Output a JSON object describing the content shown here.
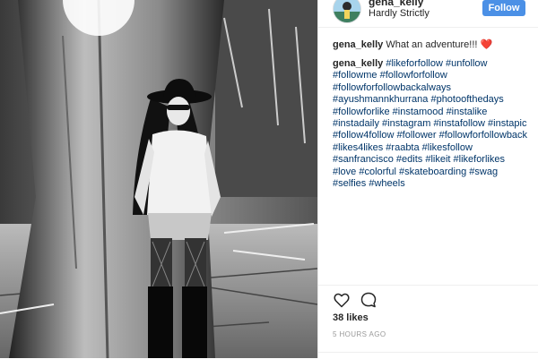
{
  "post": {
    "username": "gena_kelly",
    "location": "Hardly Strictly",
    "follow_label": "Follow",
    "caption": {
      "username": "gena_kelly",
      "text": "What an adventure!!! ❤️"
    },
    "hashtag_comment": {
      "username": "gena_kelly",
      "text": "#likeforfollow #unfollow #followme #followforfollow #followforfollowbackalways #ayushmannkhurrana #photoofthedays #followforlike #instamood #instalike #instadaily #instagram #instafollow #instapic #follow4follow #follower #followforfollowback #likes4likes #raabta #likesfollow #sanfrancisco #edits #likeit #likeforlikes #love #colorful #skateboarding #swag #selfies #wheels"
    },
    "likes": "38 likes",
    "timestamp": "5 HOURS AGO"
  },
  "icons": {
    "like": "heart-icon",
    "comment": "comment-icon"
  },
  "colors": {
    "follow_button": "#4b90e6",
    "hashtag": "#003569",
    "timestamp": "#999999"
  }
}
